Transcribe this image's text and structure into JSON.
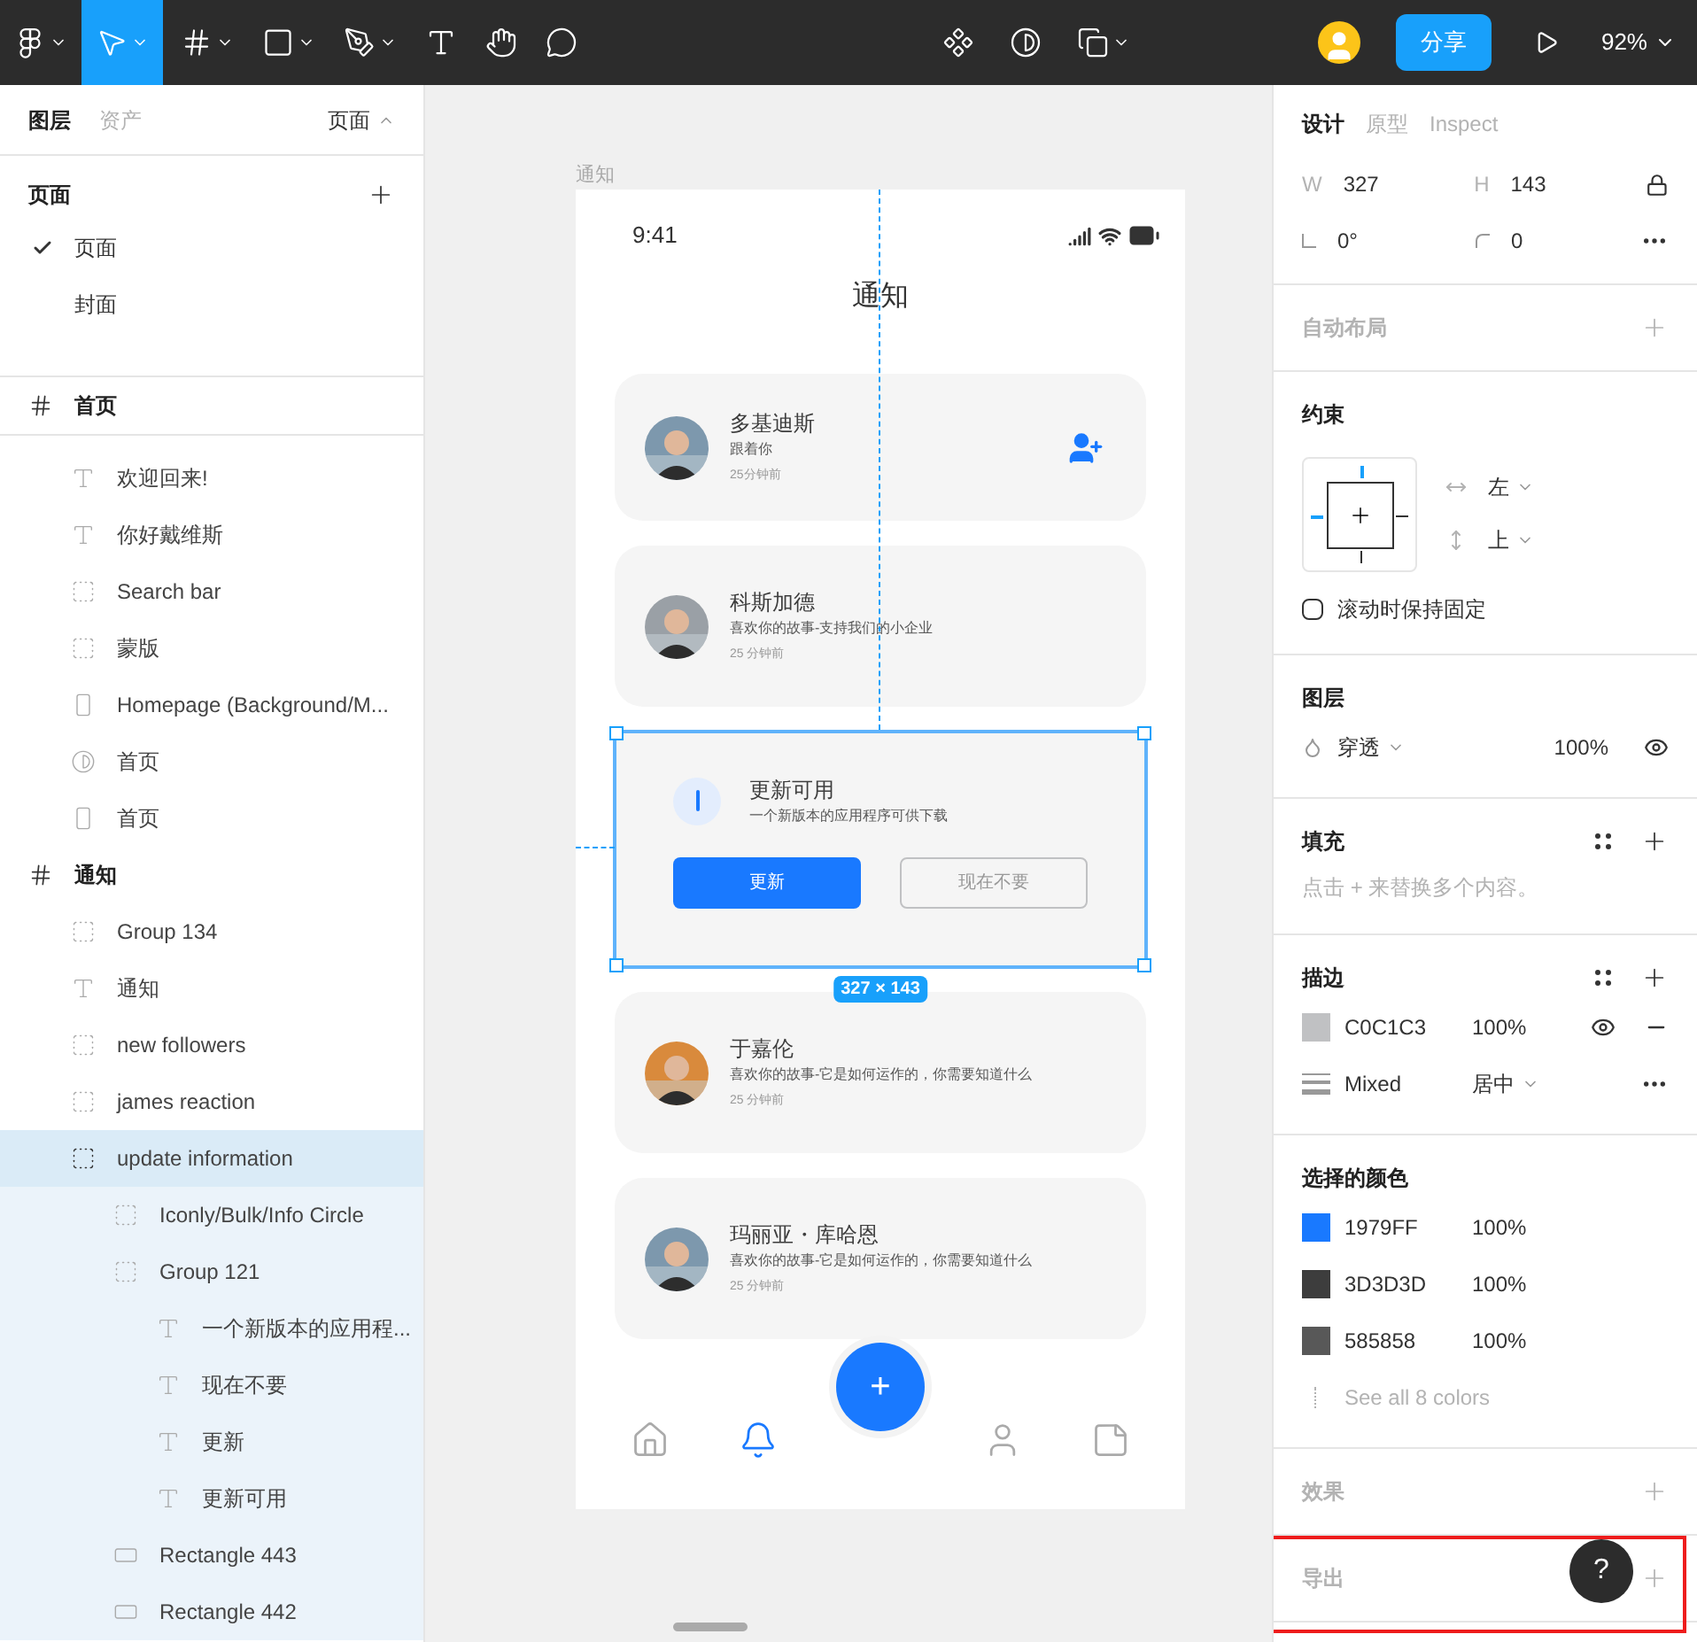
{
  "toolbar": {
    "tools": [
      {
        "kind": "logo",
        "selected": false,
        "menu": true
      },
      {
        "kind": "move",
        "selected": true,
        "menu": true
      },
      {
        "kind": "frame",
        "selected": false,
        "menu": true
      },
      {
        "kind": "shape",
        "selected": false,
        "menu": true
      },
      {
        "kind": "pen",
        "selected": false,
        "menu": true
      },
      {
        "kind": "text",
        "selected": false,
        "menu": false
      },
      {
        "kind": "hand",
        "selected": false,
        "menu": false
      },
      {
        "kind": "comment",
        "selected": false,
        "menu": false
      }
    ],
    "center_tools": [
      {
        "kind": "component",
        "menu": false
      },
      {
        "kind": "mask",
        "menu": false
      },
      {
        "kind": "boolean",
        "menu": true
      }
    ],
    "share_button": "分享",
    "zoom": "92%"
  },
  "layers_panel": {
    "tabs": [
      {
        "label": "图层",
        "selected": true
      },
      {
        "label": "资产",
        "selected": false
      }
    ],
    "page_menu": "页面",
    "pages_title": "页面",
    "pages": [
      {
        "label": "页面",
        "checked": true
      },
      {
        "label": "封面",
        "checked": false
      }
    ],
    "layers": [
      {
        "name": "首页",
        "kind": "frame",
        "selected": false,
        "children": [
          {
            "name": "欢迎回来!",
            "kind": "text",
            "selected": false
          },
          {
            "name": "你好戴维斯",
            "kind": "text",
            "selected": false
          },
          {
            "name": "Search bar",
            "kind": "group",
            "selected": false
          },
          {
            "name": "蒙版",
            "kind": "group",
            "selected": false
          },
          {
            "name": "Homepage (Background/M...",
            "selected": false
          },
          {
            "name": "首页",
            "kind": "mask",
            "selected": false
          },
          {
            "name": "首页",
            "selected": false
          }
        ]
      },
      {
        "name": "通知",
        "kind": "frame",
        "selected": false,
        "children": [
          {
            "name": "Group 134",
            "kind": "group",
            "selected": false
          },
          {
            "name": "通知",
            "kind": "text",
            "selected": false
          },
          {
            "name": "new followers",
            "kind": "group",
            "selected": false
          },
          {
            "name": "james reaction",
            "kind": "group",
            "selected": false
          },
          {
            "name": "update information",
            "kind": "group",
            "selected": true,
            "children": [
              {
                "name": "Iconly/Bulk/Info Circle",
                "kind": "group",
                "selected": false
              },
              {
                "name": "Group 121",
                "kind": "group",
                "selected": false,
                "children": [
                  {
                    "name": "一个新版本的应用程...",
                    "kind": "text",
                    "selected": false
                  },
                  {
                    "name": "现在不要",
                    "kind": "text",
                    "selected": false
                  },
                  {
                    "name": "更新",
                    "kind": "text",
                    "selected": false
                  },
                  {
                    "name": "更新可用",
                    "kind": "text",
                    "selected": false
                  }
                ]
              },
              {
                "name": "Rectangle 443",
                "kind": "rectangle",
                "selected": false
              },
              {
                "name": "Rectangle 442",
                "kind": "rectangle",
                "selected": false
              }
            ]
          }
        ]
      }
    ]
  },
  "canvas": {
    "frame_label": "通知",
    "selection_size": "327 × 143",
    "phone": {
      "time": "9:41",
      "title": "通知",
      "notifications": [
        {
          "kind": "follow",
          "selected": false,
          "name": "多基迪斯",
          "message": "跟着你",
          "time": "25分钟前"
        },
        {
          "kind": "comment",
          "selected": false,
          "name": "科斯加德",
          "message": "喜欢你的故事-支持我们的小企业",
          "time": "25 分钟前"
        },
        {
          "kind": "update",
          "selected": true,
          "title": "更新可用",
          "message": "一个新版本的应用程序可供下载",
          "primary": "更新",
          "secondary": "现在不要"
        },
        {
          "kind": "comment",
          "selected": false,
          "name": "于嘉伦",
          "message": "喜欢你的故事-它是如何运作的，你需要知道什么",
          "time": "25 分钟前"
        },
        {
          "kind": "comment",
          "selected": false,
          "name": "玛丽亚・库哈恩",
          "message": "喜欢你的故事-它是如何运作的，你需要知道什么",
          "time": "25 分钟前"
        }
      ],
      "fab": "+",
      "nav": [
        {
          "kind": "home",
          "selected": false
        },
        {
          "kind": "bell",
          "selected": true
        },
        {
          "kind": "profile",
          "selected": false
        },
        {
          "kind": "note",
          "selected": false
        }
      ]
    }
  },
  "design_panel": {
    "tabs": [
      {
        "label": "设计",
        "selected": true
      },
      {
        "label": "原型",
        "selected": false
      },
      {
        "label": "Inspect",
        "selected": false
      }
    ],
    "fields": [
      {
        "label": "W",
        "value": "327"
      },
      {
        "label": "H",
        "value": "143"
      }
    ],
    "rotation": "0°",
    "radius": "0",
    "auto_layout": {
      "title": "自动布局"
    },
    "constraints": {
      "title": "约束",
      "horizontal": "左",
      "vertical": "上",
      "fixed_label": "滚动时保持固定",
      "fixed_checked": false
    },
    "layer": {
      "title": "图层",
      "blend": "穿透",
      "opacity": "100%"
    },
    "fill": {
      "title": "填充",
      "hint": "点击 + 来替换多个内容。"
    },
    "stroke": {
      "title": "描边",
      "color": "#c0c1c3",
      "hex": "C0C1C3",
      "opacity": "100%",
      "weight": "Mixed",
      "align": "居中"
    },
    "selection_colors": {
      "title": "选择的颜色",
      "colors": [
        {
          "hex": "1979FF",
          "color": "#1979ff",
          "opacity": "100%"
        },
        {
          "hex": "3D3D3D",
          "color": "#3d3d3d",
          "opacity": "100%"
        },
        {
          "hex": "585858",
          "color": "#585858",
          "opacity": "100%"
        }
      ],
      "more": "See all 8 colors"
    },
    "effects": {
      "title": "效果"
    },
    "export": {
      "title": "导出",
      "highlighted": true
    },
    "help": "?"
  }
}
